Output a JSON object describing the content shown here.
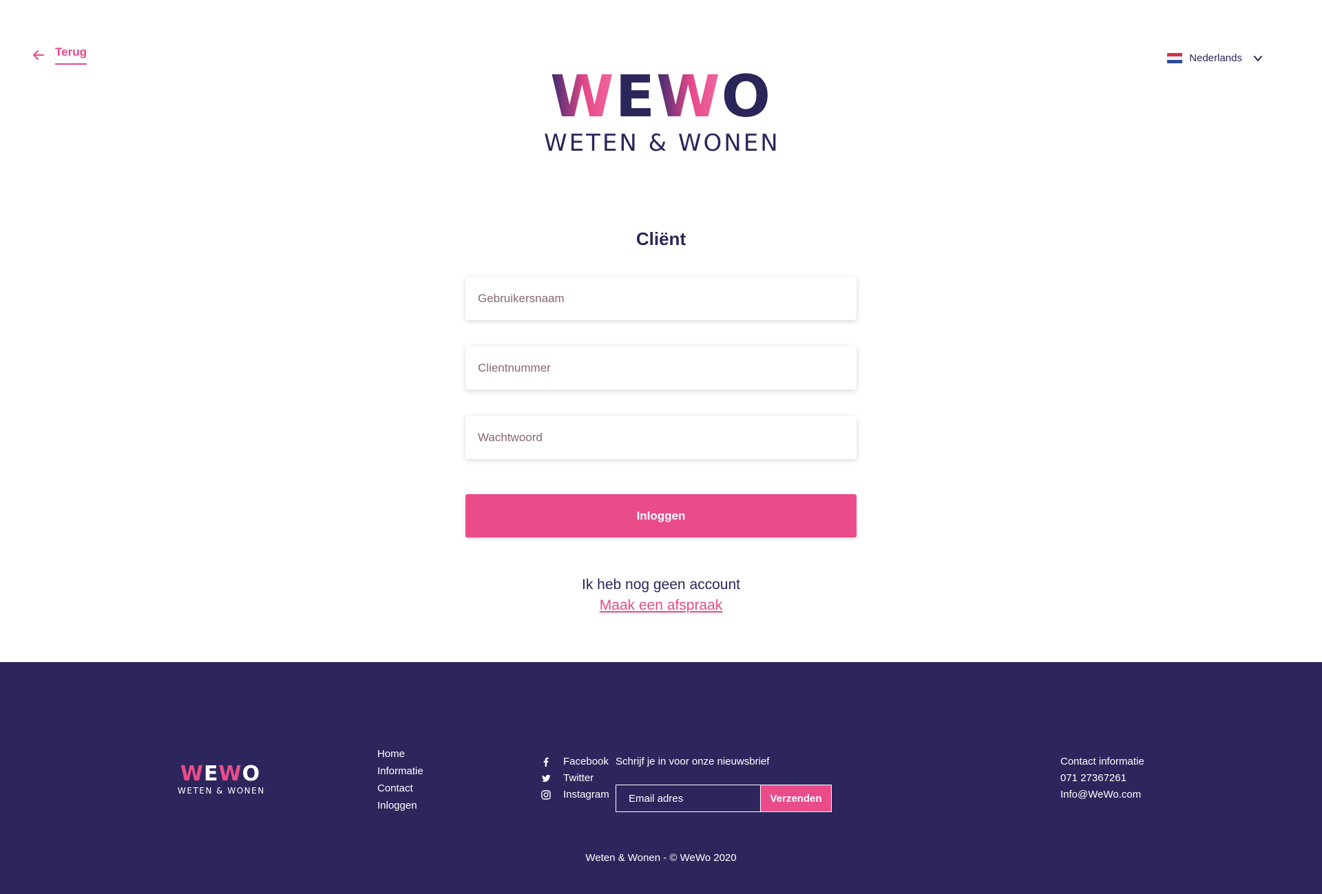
{
  "header": {
    "back_label": "Terug",
    "language": "Nederlands",
    "logo_main": [
      "W",
      "E",
      "W",
      "O"
    ],
    "logo_sub": "WETEN & WONEN"
  },
  "form": {
    "title": "Cliënt",
    "username_placeholder": "Gebruikersnaam",
    "client_number_placeholder": "Clientnummer",
    "password_placeholder": "Wachtwoord",
    "login_label": "Inloggen",
    "no_account_text": "Ik heb nog geen account",
    "appointment_link": "Maak een afspraak"
  },
  "footer": {
    "logo_main": [
      "W",
      "E",
      "W",
      "O"
    ],
    "logo_sub": "WETEN & WONEN",
    "nav": [
      "Home",
      "Informatie",
      "Contact",
      "Inloggen"
    ],
    "social": [
      {
        "label": "Facebook",
        "icon": "facebook-icon"
      },
      {
        "label": "Twitter",
        "icon": "twitter-icon"
      },
      {
        "label": "Instagram",
        "icon": "instagram-icon"
      }
    ],
    "newsletter_label": "Schrijf je in voor onze nieuwsbrief",
    "email_placeholder": "Email adres",
    "send_label": "Verzenden",
    "contact": [
      "Contact informatie",
      "071 27367261",
      "Info@WeWo.com"
    ],
    "copyright": "Weten & Wonen - © WeWo 2020"
  },
  "colors": {
    "brand_pink": "#ea4c8a",
    "brand_navy": "#2c265c"
  }
}
